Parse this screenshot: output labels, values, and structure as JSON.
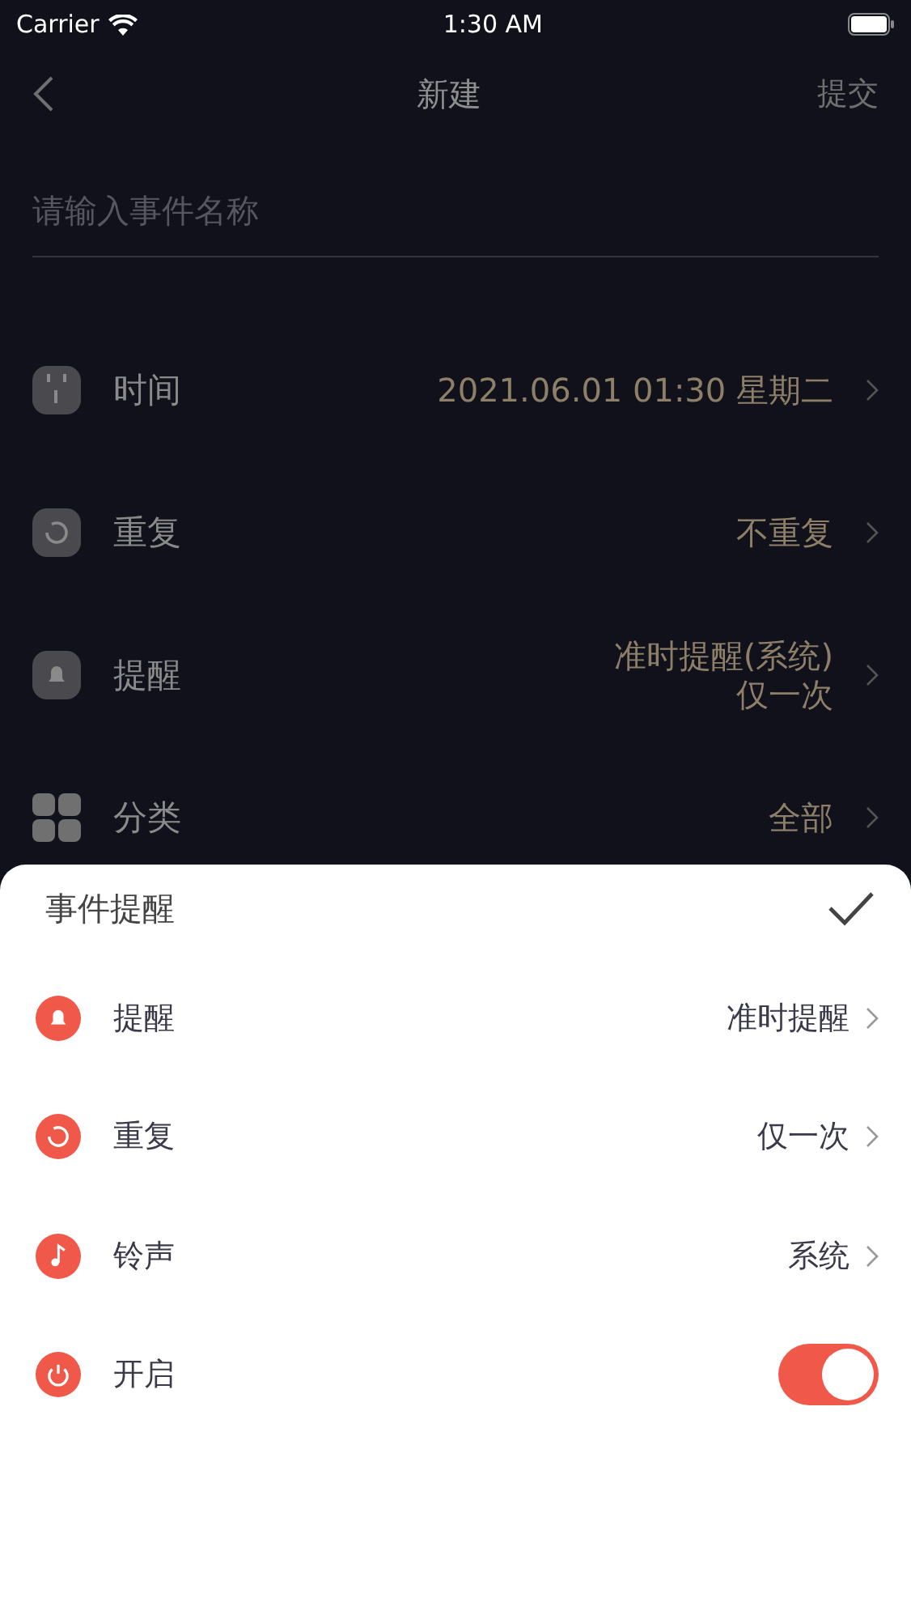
{
  "status_bar": {
    "carrier": "Carrier",
    "time": "1:30 AM"
  },
  "nav": {
    "title": "新建",
    "action": "提交"
  },
  "name_field": {
    "placeholder": "请输入事件名称"
  },
  "rows": [
    {
      "label": "时间",
      "value": [
        "2021.06.01 01:30 星期二"
      ]
    },
    {
      "label": "重复",
      "value": [
        "不重复"
      ]
    },
    {
      "label": "提醒",
      "value": [
        "准时提醒(系统)",
        "仅一次"
      ]
    },
    {
      "label": "分类",
      "value": [
        "全部"
      ]
    }
  ],
  "sheet": {
    "title": "事件提醒",
    "items": [
      {
        "kind": "select",
        "label": "提醒",
        "value": "准时提醒"
      },
      {
        "kind": "select",
        "label": "重复",
        "value": "仅一次"
      },
      {
        "kind": "select",
        "label": "铃声",
        "value": "系统"
      },
      {
        "kind": "toggle",
        "label": "开启",
        "on": true
      }
    ]
  }
}
